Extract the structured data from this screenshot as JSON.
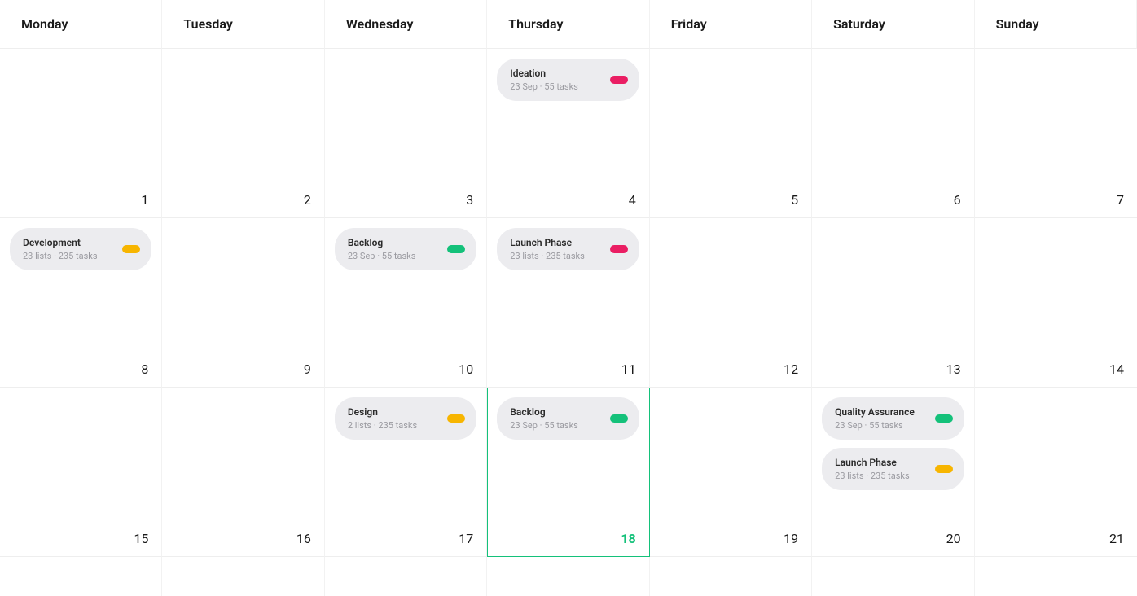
{
  "days": [
    "Monday",
    "Tuesday",
    "Wednesday",
    "Thursday",
    "Friday",
    "Saturday",
    "Sunday"
  ],
  "weeks": [
    {
      "cells": [
        {
          "date": "1",
          "events": []
        },
        {
          "date": "2",
          "events": []
        },
        {
          "date": "3",
          "events": []
        },
        {
          "date": "4",
          "events": [
            {
              "title": "Ideation",
              "meta": "23 Sep · 55 tasks",
              "color": "pink"
            }
          ]
        },
        {
          "date": "5",
          "events": []
        },
        {
          "date": "6",
          "events": []
        },
        {
          "date": "7",
          "events": []
        }
      ]
    },
    {
      "cells": [
        {
          "date": "8",
          "events": [
            {
              "title": "Development",
              "meta": "23 lists · 235 tasks",
              "color": "yellow"
            }
          ]
        },
        {
          "date": "9",
          "events": []
        },
        {
          "date": "10",
          "events": [
            {
              "title": "Backlog",
              "meta": "23 Sep · 55 tasks",
              "color": "green"
            }
          ]
        },
        {
          "date": "11",
          "events": [
            {
              "title": "Launch Phase",
              "meta": "23 lists · 235 tasks",
              "color": "pink"
            }
          ]
        },
        {
          "date": "12",
          "events": []
        },
        {
          "date": "13",
          "events": []
        },
        {
          "date": "14",
          "events": []
        }
      ]
    },
    {
      "cells": [
        {
          "date": "15",
          "events": []
        },
        {
          "date": "16",
          "events": []
        },
        {
          "date": "17",
          "events": [
            {
              "title": "Design",
              "meta": "2 lists · 235 tasks",
              "color": "yellow"
            }
          ]
        },
        {
          "date": "18",
          "today": true,
          "events": [
            {
              "title": "Backlog",
              "meta": "23 Sep · 55 tasks",
              "color": "green"
            }
          ]
        },
        {
          "date": "19",
          "events": []
        },
        {
          "date": "20",
          "events": [
            {
              "title": "Quality Assurance",
              "meta": "23 Sep · 55 tasks",
              "color": "green"
            },
            {
              "title": "Launch Phase",
              "meta": "23 lists · 235 tasks",
              "color": "yellow"
            }
          ]
        },
        {
          "date": "21",
          "events": []
        }
      ]
    }
  ]
}
